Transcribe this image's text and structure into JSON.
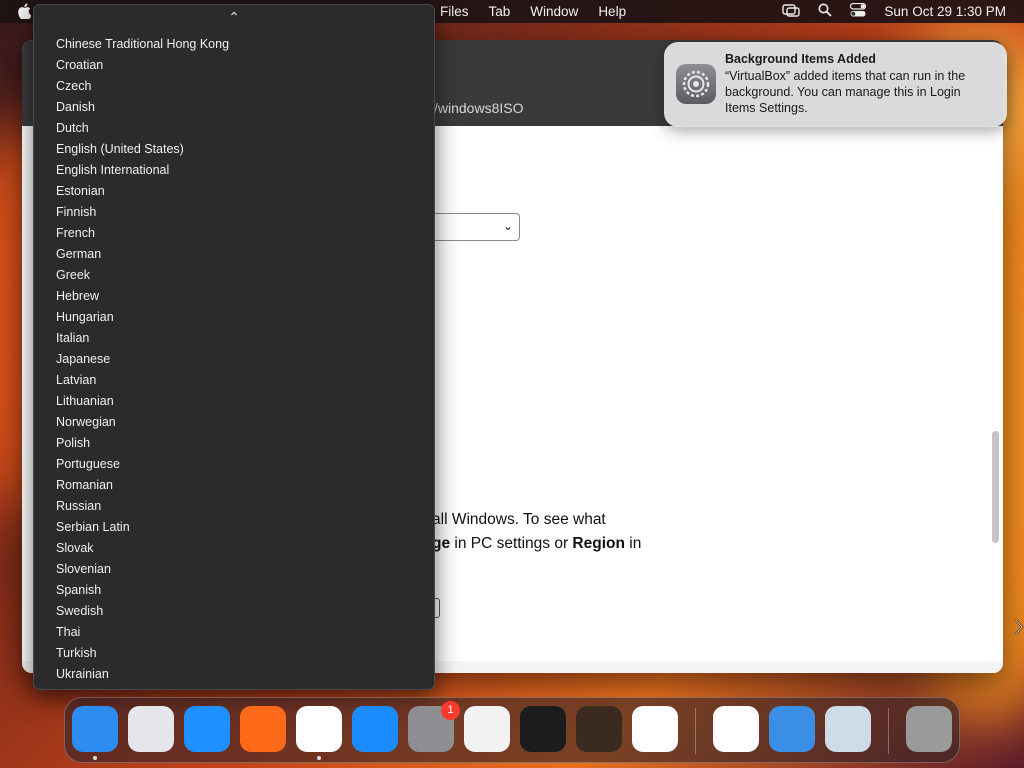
{
  "menubar": {
    "menus": [
      "Files",
      "Tab",
      "Window",
      "Help"
    ],
    "datetime": "Sun Oct 29  1:30 PM"
  },
  "browser": {
    "url_fragment": "/windows8ISO",
    "text_line1_pre": "all Windows. To see what",
    "text_line2_bold1": "ge",
    "text_line2_mid": " in PC settings or ",
    "text_line2_bold2": "Region",
    "text_line2_post": " in"
  },
  "dropdown": {
    "items": [
      "Chinese Traditional Hong Kong",
      "Croatian",
      "Czech",
      "Danish",
      "Dutch",
      "English (United States)",
      "English International",
      "Estonian",
      "Finnish",
      "French",
      "German",
      "Greek",
      "Hebrew",
      "Hungarian",
      "Italian",
      "Japanese",
      "Latvian",
      "Lithuanian",
      "Norwegian",
      "Polish",
      "Portuguese",
      "Romanian",
      "Russian",
      "Serbian Latin",
      "Slovak",
      "Slovenian",
      "Spanish",
      "Swedish",
      "Thai",
      "Turkish",
      "Ukrainian"
    ]
  },
  "notification": {
    "title": "Background Items Added",
    "body": "“VirtualBox” added items that can run in the background. You can manage this in Login Items Settings."
  },
  "dock": {
    "items": [
      {
        "name": "finder-icon",
        "color": "#2d8cf0",
        "running": true
      },
      {
        "name": "launchpad-icon",
        "color": "#e5e5ea",
        "running": false
      },
      {
        "name": "safari-icon",
        "color": "#1e90ff",
        "running": false
      },
      {
        "name": "firefox-icon",
        "color": "#ff6a1a",
        "running": false
      },
      {
        "name": "chrome-icon",
        "color": "#ffffff",
        "running": true
      },
      {
        "name": "app-store-icon",
        "color": "#1a8cff",
        "running": false
      },
      {
        "name": "system-settings-icon",
        "color": "#8e8e93",
        "running": false,
        "badge": "1"
      },
      {
        "name": "textedit-icon",
        "color": "#f2f2f2",
        "running": false
      },
      {
        "name": "terminal-icon",
        "color": "#1c1c1e",
        "running": false
      },
      {
        "name": "garageband-icon",
        "color": "#3a2a20",
        "running": false
      },
      {
        "name": "vscode-icon",
        "color": "#ffffff",
        "running": false
      },
      {
        "name": "visual-studio-icon",
        "color": "#ffffff",
        "running": false
      },
      {
        "name": "weather-icon",
        "color": "#3a8ee6",
        "running": false
      },
      {
        "name": "virtualbox-icon",
        "color": "#d0dbe8",
        "running": false
      },
      {
        "name": "trash-icon",
        "color": "#9a9a9a",
        "running": false
      }
    ]
  }
}
